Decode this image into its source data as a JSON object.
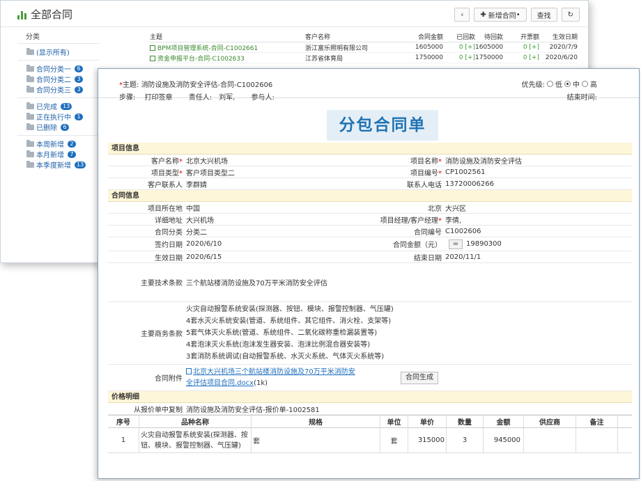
{
  "bg": {
    "title": "全部合同",
    "toolbar": {
      "prev": "‹",
      "new_label": "新增合同",
      "new_suffix": "•",
      "search": "查找",
      "refresh": "↻"
    },
    "sidebar": {
      "header": "分类",
      "all": "(显示所有)",
      "cat": [
        {
          "label": "合同分类一",
          "count": "6"
        },
        {
          "label": "合同分类二",
          "count": "3"
        },
        {
          "label": "合同分类三",
          "count": "3"
        }
      ],
      "status": [
        {
          "label": "已完成",
          "count": "13"
        },
        {
          "label": "正在执行中",
          "count": "1"
        },
        {
          "label": "已删除",
          "count": "6"
        }
      ],
      "period": [
        {
          "label": "本周新增",
          "count": "2"
        },
        {
          "label": "本月新增",
          "count": "7"
        },
        {
          "label": "本季度新增",
          "count": "13"
        }
      ]
    },
    "table": {
      "headers": [
        "主题",
        "客户名称",
        "合同金额",
        "已回款",
        "待回款",
        "开票额",
        "生效日期"
      ],
      "rows": [
        [
          "BPM项目管理系统-合同-C1002661",
          "浙江富乐照明有限公司",
          "1605000",
          "0 [+]",
          "1605000",
          "0 [+]",
          "2020/7/9"
        ],
        [
          "资金申报平台-合同-C1002633",
          "江苏省体育局",
          "1750000",
          "0 [+]",
          "1750000",
          "0 [+]",
          "2020/6/20"
        ]
      ]
    }
  },
  "fg": {
    "subject_label": "主题:",
    "subject": "消防设施及消防安全评估-合同-C1002606",
    "priority_label": "优先级:",
    "priority": [
      "低",
      "中",
      "高"
    ],
    "step_label": "步骤:",
    "step": "打印签章",
    "owner_label": "责任人:",
    "owner": "刘军,",
    "participant_label": "参与人:",
    "end_label": "结束时间:",
    "doc_title": "分包合同单",
    "sec_project": "项目信息",
    "cust_name_l": "客户名称",
    "cust_name": "北京大兴机场",
    "proj_name_l": "项目名称",
    "proj_name": "消防设施及消防安全评估",
    "proj_type_l": "项目类型",
    "proj_type": "客户项目类型二",
    "proj_no_l": "项目编号",
    "proj_no": "CP1002561",
    "contact_l": "客户联系人",
    "contact": "李群婧",
    "phone_l": "联系人电话",
    "phone": "13720006266",
    "sec_contract": "合同信息",
    "loc_l": "项目所在地",
    "loc": "中国",
    "city": "北京",
    "district": "大兴区",
    "addr_l": "详细地址",
    "addr": "大兴机场",
    "pm_l": "项目经理/客户经理",
    "pm": "李倩,",
    "class_l": "合同分类",
    "class": "分类二",
    "cno_l": "合同编号",
    "cno": "C1002606",
    "sign_l": "签约日期",
    "sign": "2020/6/10",
    "amt_l": "合同金额（元）",
    "amt_btn": "=",
    "amt": "19890300",
    "eff_l": "生效日期",
    "eff": "2020/6/15",
    "end_l": "结束日期",
    "end": "2020/11/1",
    "tech_l": "主要技术条款",
    "tech": "三个航站楼消防设施及70万平米消防安全评估",
    "biz_l": "主要商务条款",
    "biz": [
      "火灾自动报警系统安装(探测器、按钮、模块、报警控制器、气压罐)",
      "4套水灭火系统安装(管道、系统组件、其它组件、消火栓、支架等)",
      "5套气体灭火系统(管道、系统组件、二氧化碳称重检漏装置等)",
      "4套泡沫灭火系统(泡沫发生器安装、泡沫比例混合器安装等)",
      "3套消防系统调试(自动报警系统、水灭火系统、气体灭火系统等)"
    ],
    "attach_l": "合同附件",
    "attach_1": "北京大兴机场三个航站楼消防设施及70万平米消防安",
    "attach_2": "全评估项目合同.docx",
    "attach_size": "(1k)",
    "gen_btn": "合同生成",
    "sec_price": "价格明细",
    "copy_l": "从报价单中复制",
    "copy": "消防设施及消防安全评估-报价单-1002581",
    "items": {
      "headers": [
        "序号",
        "品种名称",
        "规格",
        "单位",
        "单价",
        "数量",
        "金额",
        "供应商",
        "备注"
      ],
      "row": [
        "1",
        "火灾自动报警系统安装(探测器、按钮、模块、报警控制器、气压罐)",
        "套",
        "套",
        "315000",
        "3",
        "945000",
        "",
        ""
      ]
    }
  }
}
